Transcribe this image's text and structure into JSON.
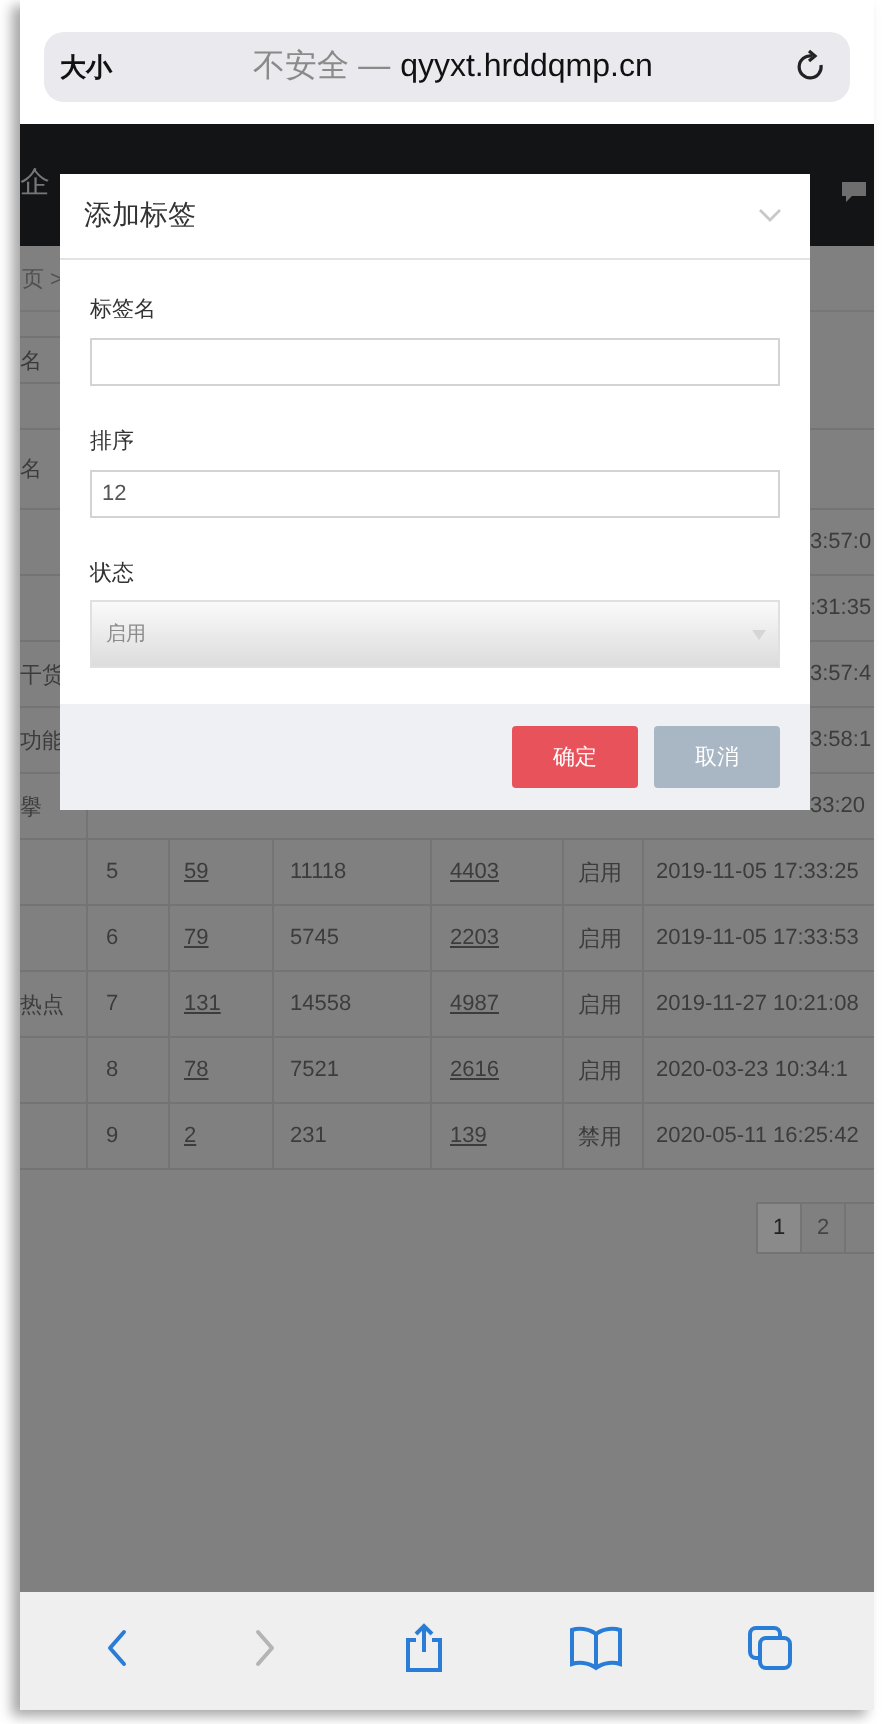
{
  "browser": {
    "text_size_button": "大小",
    "security_label": "不安全 —",
    "url": "qyyxt.hrddqmp.cn"
  },
  "page": {
    "header_title": "企",
    "breadcrumb": "页 >",
    "search_placeholder": "名",
    "table": {
      "header_column_1": "名",
      "partial_rows": [
        {
          "column_7": "3:57:0"
        },
        {
          "column_7": ":31:35"
        },
        {
          "column_1": "干货",
          "column_7": "3:57:4"
        },
        {
          "column_1": "功能",
          "column_7": "3:58:1"
        },
        {
          "column_1": "擧",
          "column_7": "33:20"
        }
      ],
      "rows": [
        {
          "column_2": "5",
          "column_3": "59",
          "column_4": "11118",
          "column_5": "4403",
          "column_6": "启用",
          "column_7": "2019-11-05 17:33:25"
        },
        {
          "column_2": "6",
          "column_3": "79",
          "column_4": "5745",
          "column_5": "2203",
          "column_6": "启用",
          "column_7": "2019-11-05 17:33:53"
        },
        {
          "column_1": "热点",
          "column_2": "7",
          "column_3": "131",
          "column_4": "14558",
          "column_5": "4987",
          "column_6": "启用",
          "column_7": "2019-11-27 10:21:08"
        },
        {
          "column_2": "8",
          "column_3": "78",
          "column_4": "7521",
          "column_5": "2616",
          "column_6": "启用",
          "column_7": "2020-03-23 10:34:1"
        },
        {
          "column_2": "9",
          "column_3": "2",
          "column_4": "231",
          "column_5": "139",
          "column_6": "禁用",
          "column_7": "2020-05-11 16:25:42"
        }
      ]
    },
    "pagination": [
      {
        "label": "1",
        "selected": true
      },
      {
        "label": "2",
        "selected": false
      }
    ]
  },
  "dialog": {
    "title": "添加标签",
    "fields": [
      {
        "kind": "text",
        "label": "标签名"
      },
      {
        "kind": "text",
        "label": "排序",
        "value": "12"
      },
      {
        "kind": "select",
        "label": "状态",
        "value": "启用"
      }
    ],
    "buttons": [
      {
        "kind": "primary",
        "label": "确定"
      },
      {
        "kind": "secondary",
        "label": "取消"
      }
    ]
  },
  "toolbar": [
    {
      "kind": "back",
      "disabled": false
    },
    {
      "kind": "forward",
      "disabled": true
    },
    {
      "kind": "share",
      "disabled": false
    },
    {
      "kind": "bookmarks",
      "disabled": false
    },
    {
      "kind": "tabs",
      "disabled": false
    }
  ]
}
